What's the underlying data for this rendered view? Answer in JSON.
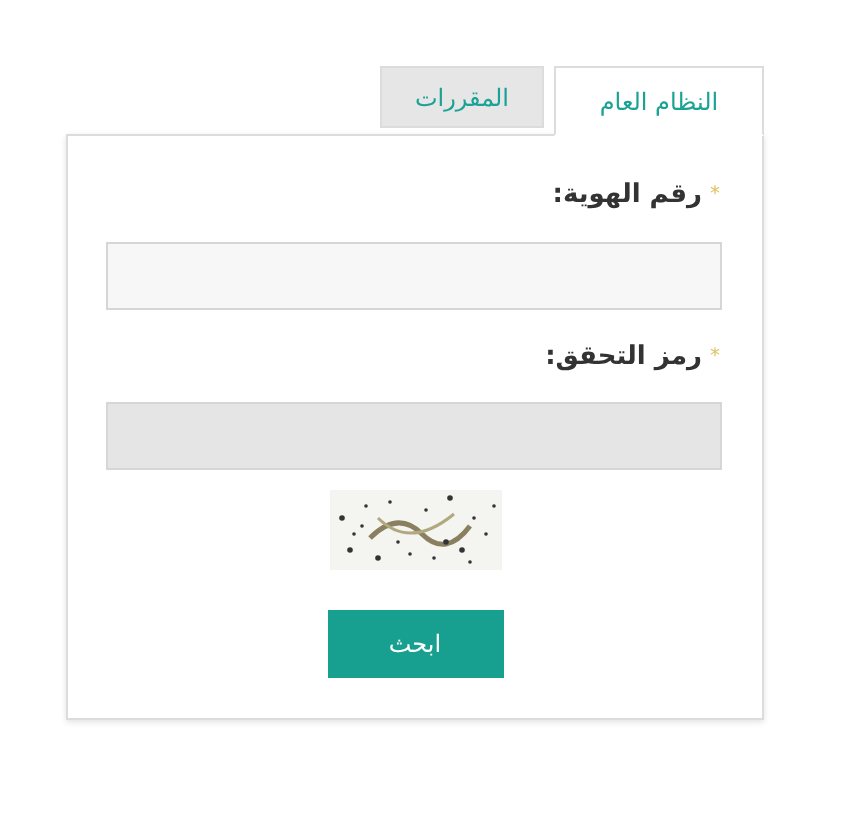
{
  "tabs": [
    {
      "label": "النظام العام",
      "selected": true
    },
    {
      "label": "المقررات",
      "selected": false
    }
  ],
  "fields": [
    {
      "label": "رقم الهوية:",
      "required_mark": "*",
      "disabled": false
    },
    {
      "label": "رمز التحقق:",
      "required_mark": "*",
      "disabled": true
    }
  ],
  "button": "ابحث"
}
